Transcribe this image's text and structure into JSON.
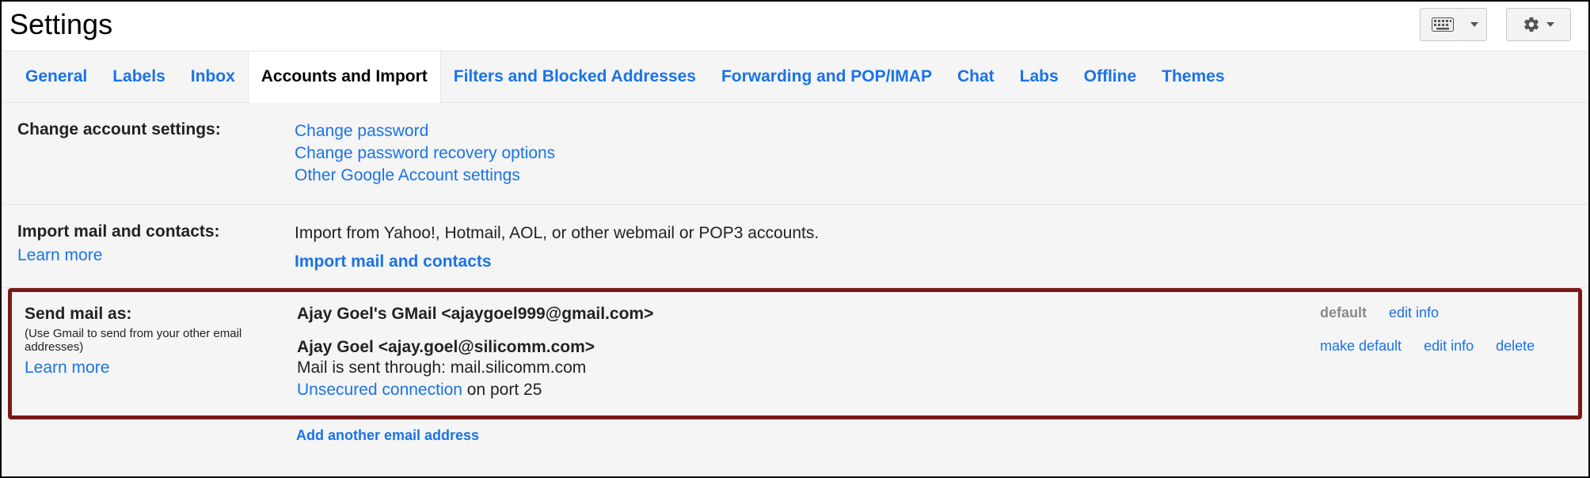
{
  "title": "Settings",
  "tabs": [
    "General",
    "Labels",
    "Inbox",
    "Accounts and Import",
    "Filters and Blocked Addresses",
    "Forwarding and POP/IMAP",
    "Chat",
    "Labs",
    "Offline",
    "Themes"
  ],
  "change": {
    "label": "Change account settings:",
    "pw": "Change password",
    "rec": "Change password recovery options",
    "other": "Other Google Account settings"
  },
  "import": {
    "label": "Import mail and contacts:",
    "more": "Learn more",
    "desc": "Import from Yahoo!, Hotmail, AOL, or other webmail or POP3 accounts.",
    "link": "Import mail and contacts"
  },
  "sma": {
    "label": "Send mail as:",
    "hint": "(Use Gmail to send from your other email addresses)",
    "more": "Learn more",
    "add": "Add another email address"
  },
  "acct1": {
    "name": "Ajay Goel's GMail <ajaygoel999@gmail.com>",
    "default": "default",
    "edit": "edit info"
  },
  "acct2": {
    "name": "Ajay Goel <ajay.goel@silicomm.com>",
    "through": "Mail is sent through: mail.silicomm.com",
    "unsec": "Unsecured connection",
    "port": " on port 25",
    "makedef": "make default",
    "edit": "edit info",
    "del": "delete"
  }
}
